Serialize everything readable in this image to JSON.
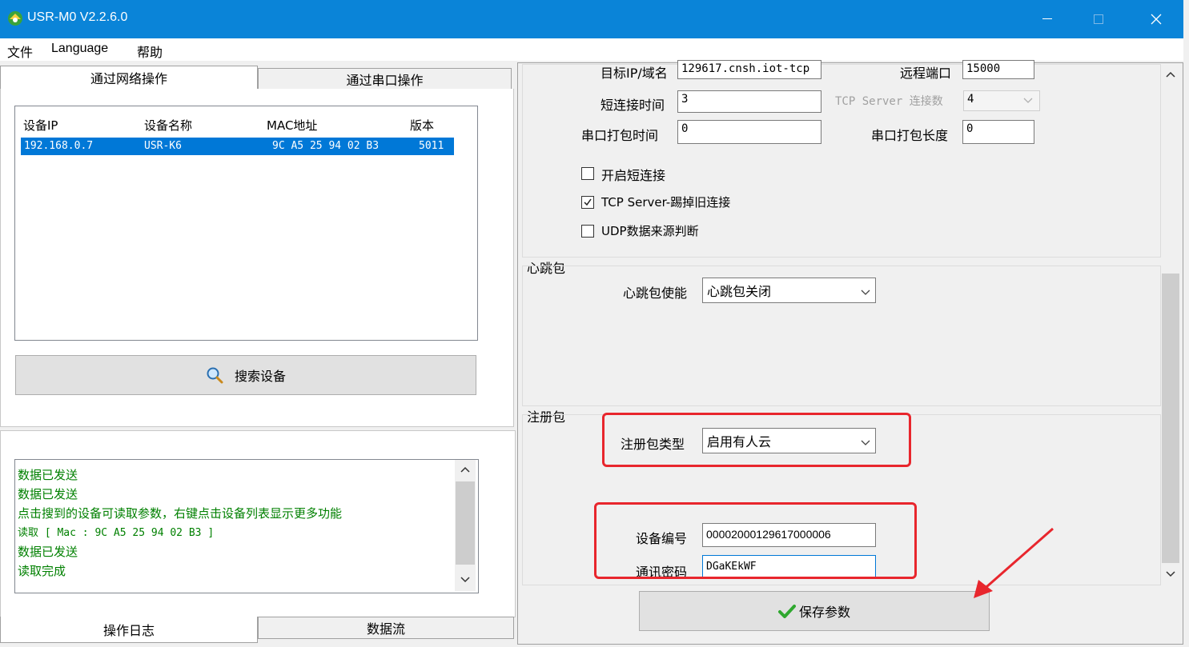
{
  "window": {
    "title": "USR-M0 V2.2.6.0"
  },
  "menu": [
    "文件",
    "Language",
    "帮助"
  ],
  "top_tabs": {
    "network": "通过网络操作",
    "serial": "通过串口操作"
  },
  "device_list": {
    "columns": [
      "设备IP",
      "设备名称",
      "MAC地址",
      "版本"
    ],
    "rows": [
      {
        "ip": "192.168.0.7",
        "name": "USR-K6",
        "mac": "9C A5 25 94 02 B3",
        "version": "5011"
      }
    ]
  },
  "search_button": "搜索设备",
  "log": {
    "lines": [
      "数据已发送",
      "数据已发送",
      "点击搜到的设备可读取参数，右键点击设备列表显示更多功能",
      "读取 [ Mac : 9C A5 25 94 02 B3 ]",
      "数据已发送",
      "读取完成"
    ]
  },
  "bottom_tabs": {
    "log": "操作日志",
    "stream": "数据流"
  },
  "settings": {
    "target_label": "目标IP/域名",
    "target_value": "129617.cnsh.iot-tcp",
    "remote_port_label": "远程端口",
    "remote_port_value": "15000",
    "short_conn_label": "短连接时间",
    "short_conn_value": "3",
    "tcp_server_conn_label": "TCP Server 连接数",
    "tcp_server_conn_value": "4",
    "pack_time_label": "串口打包时间",
    "pack_time_value": "0",
    "pack_len_label": "串口打包长度",
    "pack_len_value": "0",
    "check_short": "开启短连接",
    "check_kick": "TCP Server-踢掉旧连接",
    "check_udp": "UDP数据来源判断"
  },
  "heartbeat": {
    "group": "心跳包",
    "enable_label": "心跳包使能",
    "enable_value": "心跳包关闭"
  },
  "register": {
    "group": "注册包",
    "type_label": "注册包类型",
    "type_value": "启用有人云",
    "device_id_label": "设备编号",
    "device_id_value": "00002000129617000006",
    "password_label": "通讯密码",
    "password_value": "DGaKEkWF"
  },
  "save_button": "保存参数",
  "colors": {
    "titlebar": "#0a84d8",
    "selection": "#0078d7",
    "log_text": "#008000",
    "annotation": "#e8262d"
  }
}
